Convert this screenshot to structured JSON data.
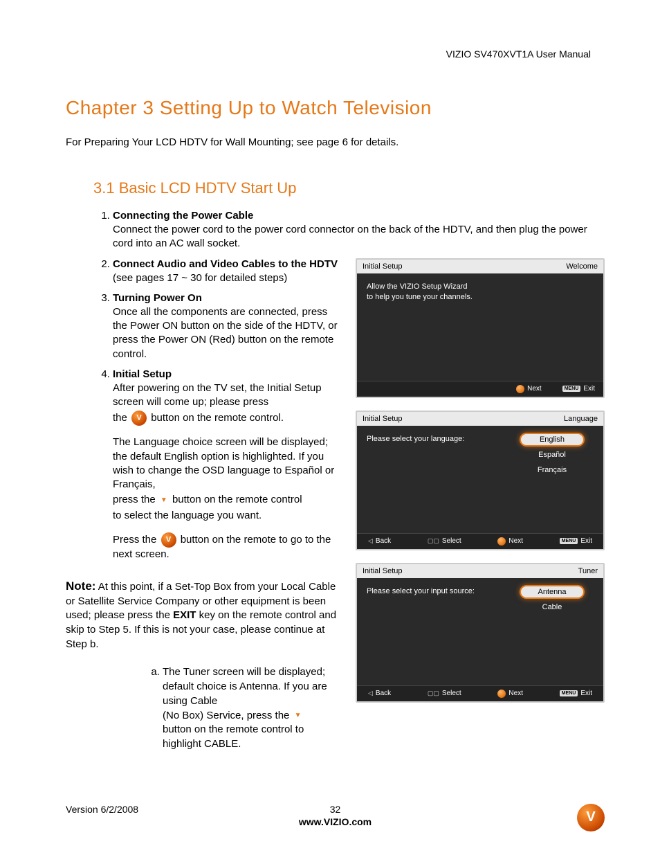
{
  "header": {
    "product": "VIZIO SV470XVT1A User Manual"
  },
  "chapter": {
    "title": "Chapter 3 Setting Up to Watch Television",
    "intro": "For Preparing Your LCD HDTV for Wall Mounting; see page 6 for details."
  },
  "section": {
    "title": "3.1 Basic LCD HDTV Start Up"
  },
  "steps": {
    "s1": {
      "title": "Connecting the Power Cable",
      "body": "Connect the power cord to the power cord connector on the back of the HDTV, and then plug the power cord into an AC wall socket."
    },
    "s2": {
      "title": "Connect Audio and Video Cables to the HDTV",
      "body": "(see pages 17 ~ 30 for detailed steps)"
    },
    "s3": {
      "title": "Turning Power On",
      "body": "Once all the components are connected, press the Power ON button on the side of the HDTV, or press the Power ON (Red) button on the remote control."
    },
    "s4": {
      "title": "Initial Setup",
      "p1": "After powering on the TV set, the Initial Setup screen will come up; please press",
      "p1a": "the ",
      "p1b": " button on the remote control.",
      "p2": "The Language choice screen will be displayed; the default English option is highlighted.  If you wish to change the OSD language to Español or Français,",
      "p2a": "press the ",
      "p2b": " button on the remote control",
      "p2c": "to select the language you want.",
      "p3a": "Press the ",
      "p3b": " button on the remote to go to the next screen."
    }
  },
  "note": {
    "label": "Note:",
    "body1": "At this point, if a Set-Top Box from your Local Cable or Satellite Service Company or other equipment is been used; please press the ",
    "exit": "EXIT",
    "body2": " key on the remote control and skip to Step 5. If this is not your case, please continue at Step b.",
    "sub_a_1": "The Tuner screen will be displayed; default choice is Antenna.  If you are using Cable",
    "sub_a_2a": "(No Box) Service, press the ",
    "sub_a_3": "button on the remote control to highlight CABLE."
  },
  "tv": {
    "panel1": {
      "left": "Initial Setup",
      "right": "Welcome",
      "line1": "Allow the VIZIO Setup Wizard",
      "line2": "to help you tune your channels.",
      "next": "Next",
      "exit": "Exit",
      "menu": "MENU"
    },
    "panel2": {
      "left": "Initial Setup",
      "right": "Language",
      "prompt": "Please select your language:",
      "opt1": "English",
      "opt2": "Español",
      "opt3": "Français",
      "back": "Back",
      "select": "Select",
      "next": "Next",
      "exit": "Exit",
      "menu": "MENU"
    },
    "panel3": {
      "left": "Initial Setup",
      "right": "Tuner",
      "prompt": "Please select your input source:",
      "opt1": "Antenna",
      "opt2": "Cable",
      "back": "Back",
      "select": "Select",
      "next": "Next",
      "exit": "Exit",
      "menu": "MENU"
    }
  },
  "footer": {
    "version": "Version 6/2/2008",
    "page": "32",
    "site": "www.VIZIO.com"
  }
}
